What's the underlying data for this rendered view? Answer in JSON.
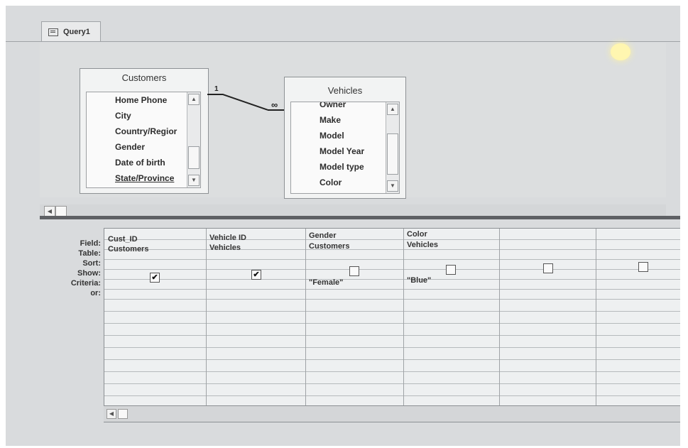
{
  "tab": {
    "label": "Query1"
  },
  "tables": [
    {
      "title": "Customers",
      "fields": [
        "Home Phone",
        "City",
        "Country/Regior",
        "Gender",
        "Date of birth",
        "State/Province"
      ]
    },
    {
      "title": "Vehicles",
      "fields": [
        "Owner",
        "Make",
        "Model",
        "Model Year",
        "Model type",
        "Color"
      ]
    }
  ],
  "relationship": {
    "one": "1",
    "many": "∞"
  },
  "grid": {
    "row_labels": [
      "Field:",
      "Table:",
      "Sort:",
      "Show:",
      "Criteria:",
      "or:"
    ],
    "columns": [
      {
        "field": "Cust_ID",
        "table": "Customers",
        "show": true,
        "criteria": ""
      },
      {
        "field": "Vehicle ID",
        "table": "Vehicles",
        "show": true,
        "criteria": ""
      },
      {
        "field": "Gender",
        "table": "Customers",
        "show": false,
        "criteria": "\"Female\""
      },
      {
        "field": "Color",
        "table": "Vehicles",
        "show": false,
        "criteria": "\"Blue\""
      },
      {
        "field": "",
        "table": "",
        "show": false,
        "criteria": ""
      },
      {
        "field": "",
        "table": "",
        "show": false,
        "criteria": ""
      }
    ]
  }
}
